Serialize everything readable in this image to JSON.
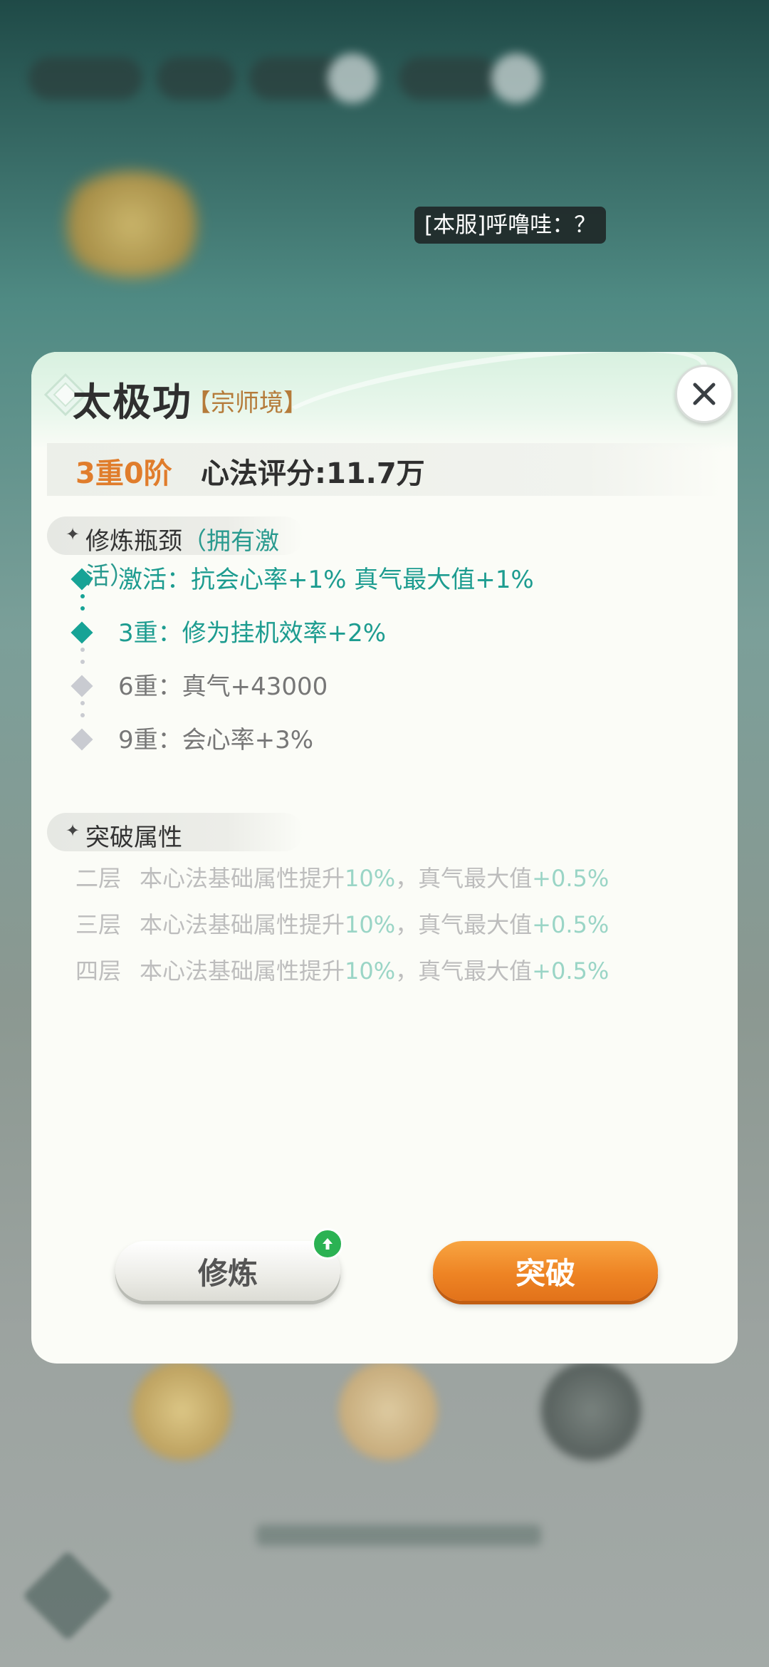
{
  "chat": {
    "message": "[本服]呼噜哇：？"
  },
  "dialog": {
    "title": "太极功",
    "realm": "【宗师境】",
    "close_icon": "close-icon",
    "level": "3重0阶",
    "score": "心法评分:11.7万",
    "bottleneck": {
      "section_label": "修炼瓶颈",
      "section_note": "（拥有激活）",
      "items": [
        {
          "text": "激活：抗会心率+1%  真气最大值+1%",
          "active": true
        },
        {
          "text": "3重：修为挂机效率+2%",
          "active": true
        },
        {
          "text": "6重：真气+43000",
          "active": false
        },
        {
          "text": "9重：会心率+3%",
          "active": false
        }
      ]
    },
    "breakthrough": {
      "section_label": "突破属性",
      "rows": [
        {
          "level": "二层",
          "text_a": "本心法基础属性提升",
          "val_a": "10%",
          "text_b": "，真气最大值",
          "val_b": "+0.5%"
        },
        {
          "level": "三层",
          "text_a": "本心法基础属性提升",
          "val_a": "10%",
          "text_b": "，真气最大值",
          "val_b": "+0.5%"
        },
        {
          "level": "四层",
          "text_a": "本心法基础属性提升",
          "val_a": "10%",
          "text_b": "，真气最大值",
          "val_b": "+0.5%"
        }
      ]
    },
    "buttons": {
      "cultivate": "修炼",
      "breakthrough": "突破"
    }
  },
  "colors": {
    "accent_teal": "#1d9c90",
    "level_orange": "#e07d2c",
    "button_orange": "#ee8424",
    "upgrade_green": "#2bb253"
  }
}
